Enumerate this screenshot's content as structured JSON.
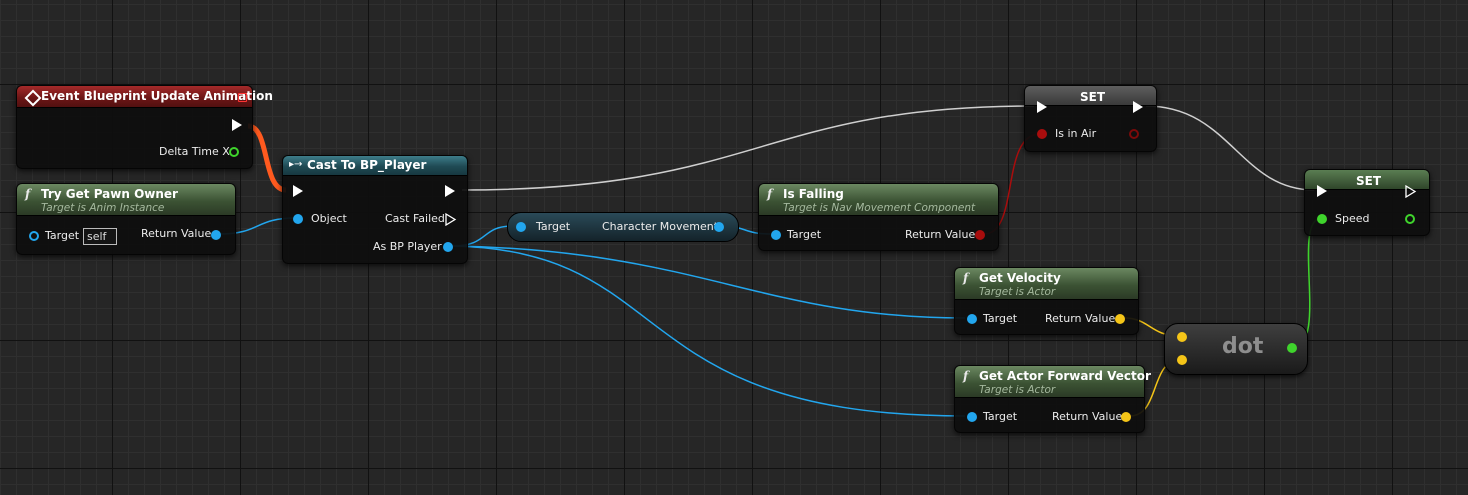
{
  "event_node": {
    "title": "Event Blueprint Update Animation",
    "delta_time_label": "Delta Time X"
  },
  "try_get_pawn_owner": {
    "title": "Try Get Pawn Owner",
    "subtitle": "Target is Anim Instance",
    "target_label": "Target",
    "target_value": "self",
    "return_label": "Return Value"
  },
  "cast_node": {
    "title": "Cast To BP_Player",
    "object_label": "Object",
    "cast_failed_label": "Cast Failed",
    "as_label": "As BP Player"
  },
  "char_movement": {
    "target_label": "Target",
    "output_label": "Character Movement"
  },
  "is_falling": {
    "title": "Is Falling",
    "subtitle": "Target is Nav Movement Component",
    "target_label": "Target",
    "return_label": "Return Value"
  },
  "set_in_air": {
    "title": "SET",
    "var_label": "Is in Air"
  },
  "set_speed": {
    "title": "SET",
    "var_label": "Speed"
  },
  "get_velocity": {
    "title": "Get Velocity",
    "subtitle": "Target is Actor",
    "target_label": "Target",
    "return_label": "Return Value"
  },
  "get_forward": {
    "title": "Get Actor Forward Vector",
    "subtitle": "Target is Actor",
    "target_label": "Target",
    "return_label": "Return Value"
  },
  "dot_node": {
    "label": "dot"
  },
  "colors": {
    "exec_wire": "#ffffff",
    "object_wire": "#22a6ee",
    "vector_wire": "#f5c518",
    "bool_wire": "#a90d0d",
    "float_wire": "#3fd42c",
    "active_exec_wire": "#ff5a1f"
  }
}
